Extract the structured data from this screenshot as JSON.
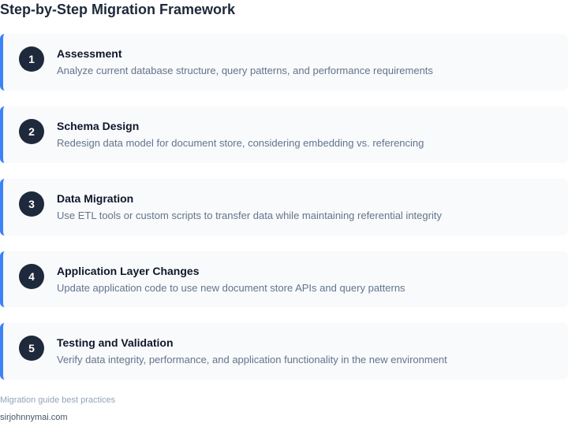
{
  "title": "Step-by-Step Migration Framework",
  "steps": [
    {
      "number": "1",
      "title": "Assessment",
      "description": "Analyze current database structure, query patterns, and performance requirements"
    },
    {
      "number": "2",
      "title": "Schema Design",
      "description": "Redesign data model for document store, considering embedding vs. referencing"
    },
    {
      "number": "3",
      "title": "Data Migration",
      "description": "Use ETL tools or custom scripts to transfer data while maintaining referential integrity"
    },
    {
      "number": "4",
      "title": "Application Layer Changes",
      "description": "Update application code to use new document store APIs and query patterns"
    },
    {
      "number": "5",
      "title": "Testing and Validation",
      "description": "Verify data integrity, performance, and application functionality in the new environment"
    }
  ],
  "footer": {
    "note": "Migration guide best practices",
    "credit": "sirjohnnymai.com"
  },
  "colors": {
    "accent_border": "#3b82f6",
    "number_badge": "#1e293b",
    "card_background": "#f8fafc"
  }
}
